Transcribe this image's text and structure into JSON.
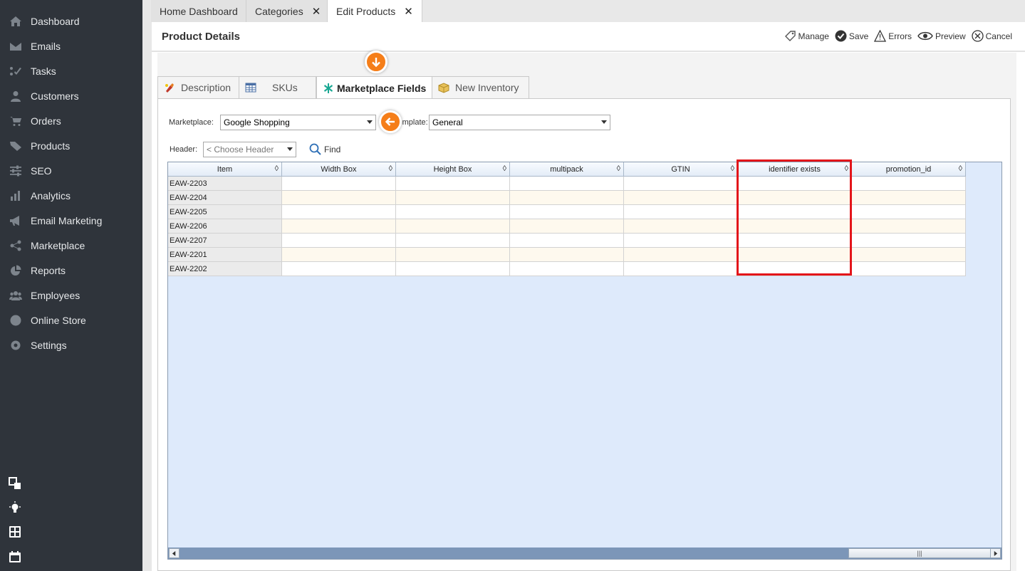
{
  "sidebar": {
    "items": [
      {
        "label": "Dashboard",
        "icon": "home-icon"
      },
      {
        "label": "Emails",
        "icon": "envelope-icon"
      },
      {
        "label": "Tasks",
        "icon": "tasks-icon"
      },
      {
        "label": "Customers",
        "icon": "user-icon"
      },
      {
        "label": "Orders",
        "icon": "cart-icon"
      },
      {
        "label": "Products",
        "icon": "tag-icon"
      },
      {
        "label": "SEO",
        "icon": "sliders-icon"
      },
      {
        "label": "Analytics",
        "icon": "bar-chart-icon"
      },
      {
        "label": "Email Marketing",
        "icon": "megaphone-icon"
      },
      {
        "label": "Marketplace",
        "icon": "share-icon"
      },
      {
        "label": "Reports",
        "icon": "pie-chart-icon"
      },
      {
        "label": "Employees",
        "icon": "users-icon"
      },
      {
        "label": "Online Store",
        "icon": "globe-icon"
      },
      {
        "label": "Settings",
        "icon": "gear-icon"
      }
    ],
    "tools": [
      "windows-icon",
      "lightbulb-icon",
      "calculator-icon",
      "calendar-icon"
    ]
  },
  "tabs": [
    {
      "label": "Home Dashboard",
      "closable": false
    },
    {
      "label": "Categories",
      "closable": true,
      "close": "✕"
    },
    {
      "label": "Edit Products",
      "closable": true,
      "close": "✕",
      "active": true
    }
  ],
  "header": {
    "title": "Product Details",
    "actions": {
      "manage": "Manage",
      "save": "Save",
      "errors": "Errors",
      "preview": "Preview",
      "cancel": "Cancel"
    }
  },
  "inner_tabs": {
    "description": "Description",
    "skus": "SKUs",
    "marketplace_fields": "Marketplace Fields",
    "new_inventory": "New Inventory"
  },
  "form": {
    "marketplace_label": "Marketplace:",
    "marketplace_value": "Google Shopping",
    "template_label": "Template:",
    "template_value": "General",
    "header_label": "Header:",
    "header_placeholder": "< Choose Header",
    "find_label": "Find"
  },
  "grid": {
    "columns": [
      "Item",
      "Width Box",
      "Height Box",
      "multipack",
      "GTIN",
      "identifier exists",
      "promotion_id"
    ],
    "sort_glyph": "◊",
    "rows": [
      "EAW-2203",
      "EAW-2204",
      "EAW-2205",
      "EAW-2206",
      "EAW-2207",
      "EAW-2201",
      "EAW-2202"
    ],
    "scroll_thumb_glyph": "|||"
  },
  "colors": {
    "sidebar_bg": "#2f343b",
    "callout": "#f57e19",
    "highlight": "#e3151a",
    "grid_bg": "#deeafb"
  }
}
